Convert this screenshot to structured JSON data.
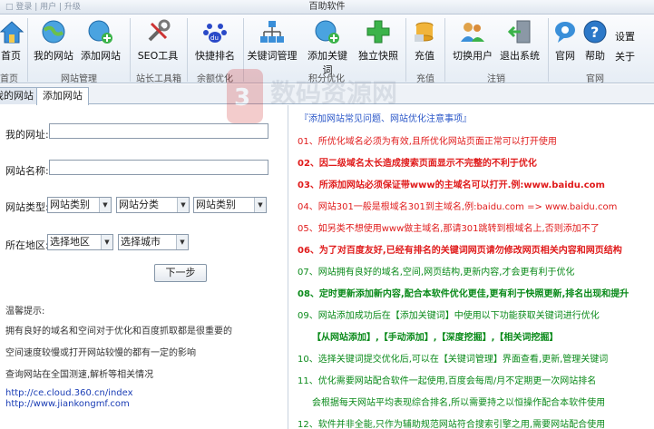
{
  "window": {
    "title": "百助软件",
    "ghost_title": "□ 登录 | 用户 | 升级"
  },
  "ribbon": {
    "tools": [
      {
        "label": "首页",
        "icon": "home-icon"
      },
      {
        "label": "我的网站",
        "icon": "globe-icon"
      },
      {
        "label": "添加网站",
        "icon": "globe-add-icon"
      },
      {
        "label": "SEO工具",
        "icon": "tools-icon"
      },
      {
        "label": "快捷排名",
        "icon": "baidu-paw-icon"
      },
      {
        "label": "关键词管理",
        "icon": "network-icon"
      },
      {
        "label": "添加关键词",
        "icon": "globe-add-icon"
      },
      {
        "label": "独立快照",
        "icon": "plus-icon"
      },
      {
        "label": "充值",
        "icon": "coins-icon"
      },
      {
        "label": "切换用户",
        "icon": "users-icon"
      },
      {
        "label": "退出系统",
        "icon": "exit-door-icon"
      },
      {
        "label": "官网",
        "icon": "chat-bubble-icon"
      },
      {
        "label": "帮助",
        "icon": "help-icon"
      },
      {
        "label": "设置",
        "icon": "settings-icon"
      }
    ],
    "extra_label": "关于",
    "groups": [
      "首页",
      "网站管理",
      "站长工具箱",
      "余额优化",
      "积分优化",
      "充值",
      "注销",
      "官网"
    ]
  },
  "tabs": [
    "我的网站",
    "添加网站"
  ],
  "form": {
    "url_label": "我的网址:",
    "name_label": "网站名称:",
    "type_label": "网站类型:",
    "type_selects": [
      "网站类别",
      "网站分类",
      "网站类别"
    ],
    "region_label": "所在地区:",
    "region_selects": [
      "选择地区",
      "选择城市"
    ],
    "next_button": "下一步"
  },
  "hints": {
    "title": "温馨提示:",
    "lines": [
      "拥有良好的域名和空间对于优化和百度抓取都是很重要的",
      "空间速度较慢或打开网站较慢的都有一定的影响",
      "查询网站在全国测速,解析等相关情况"
    ],
    "links": [
      "http://ce.cloud.360.cn/index",
      "http://www.jiankongmf.com"
    ]
  },
  "notes": {
    "heading": "『添加网站常见问题、网站优化注意事项』",
    "items": [
      "01、所优化域名必须为有效,且所优化网站页面正常可以打开使用",
      "02、因二级域名太长造成搜索页面显示不完整的不利于优化",
      "03、所添加网站必须保证带www的主域名可以打开.例:www.baidu.com",
      "04、网站301一般是根域名301到主域名,例:baidu.com => www.baidu.com",
      "05、如另类不想使用www做主域名,那请301跳转到根域名上,否则添加不了",
      "06、为了对百度友好,已经有排名的关键词网页请勿修改网页相关内容和网页结构",
      "07、网站拥有良好的域名,空间,网页结构,更新内容,才会更有利于优化",
      "08、定时更新添加新内容,配合本软件优化更佳,更有利于快照更新,排名出现和提升",
      "09、网站添加成功后在【添加关键词】中使用以下功能获取关键词进行优化",
      "【从网站添加】,【手动添加】,【深度挖掘】,【相关词挖掘】",
      "10、选择关键词提交优化后,可以在【关键词管理】界面查看,更新,管理关键词",
      "11、优化需要网站配合软件一起使用,百度会每周/月不定期更一次网站排名",
      "会根据每天网站平均表现综合排名,所以需要持之以恒操作配合本软件使用",
      "12、软件并非全能,只作为辅助规范网站符合搜索引擎之用,需要网站配合使用"
    ]
  },
  "watermark": "数码资源网"
}
